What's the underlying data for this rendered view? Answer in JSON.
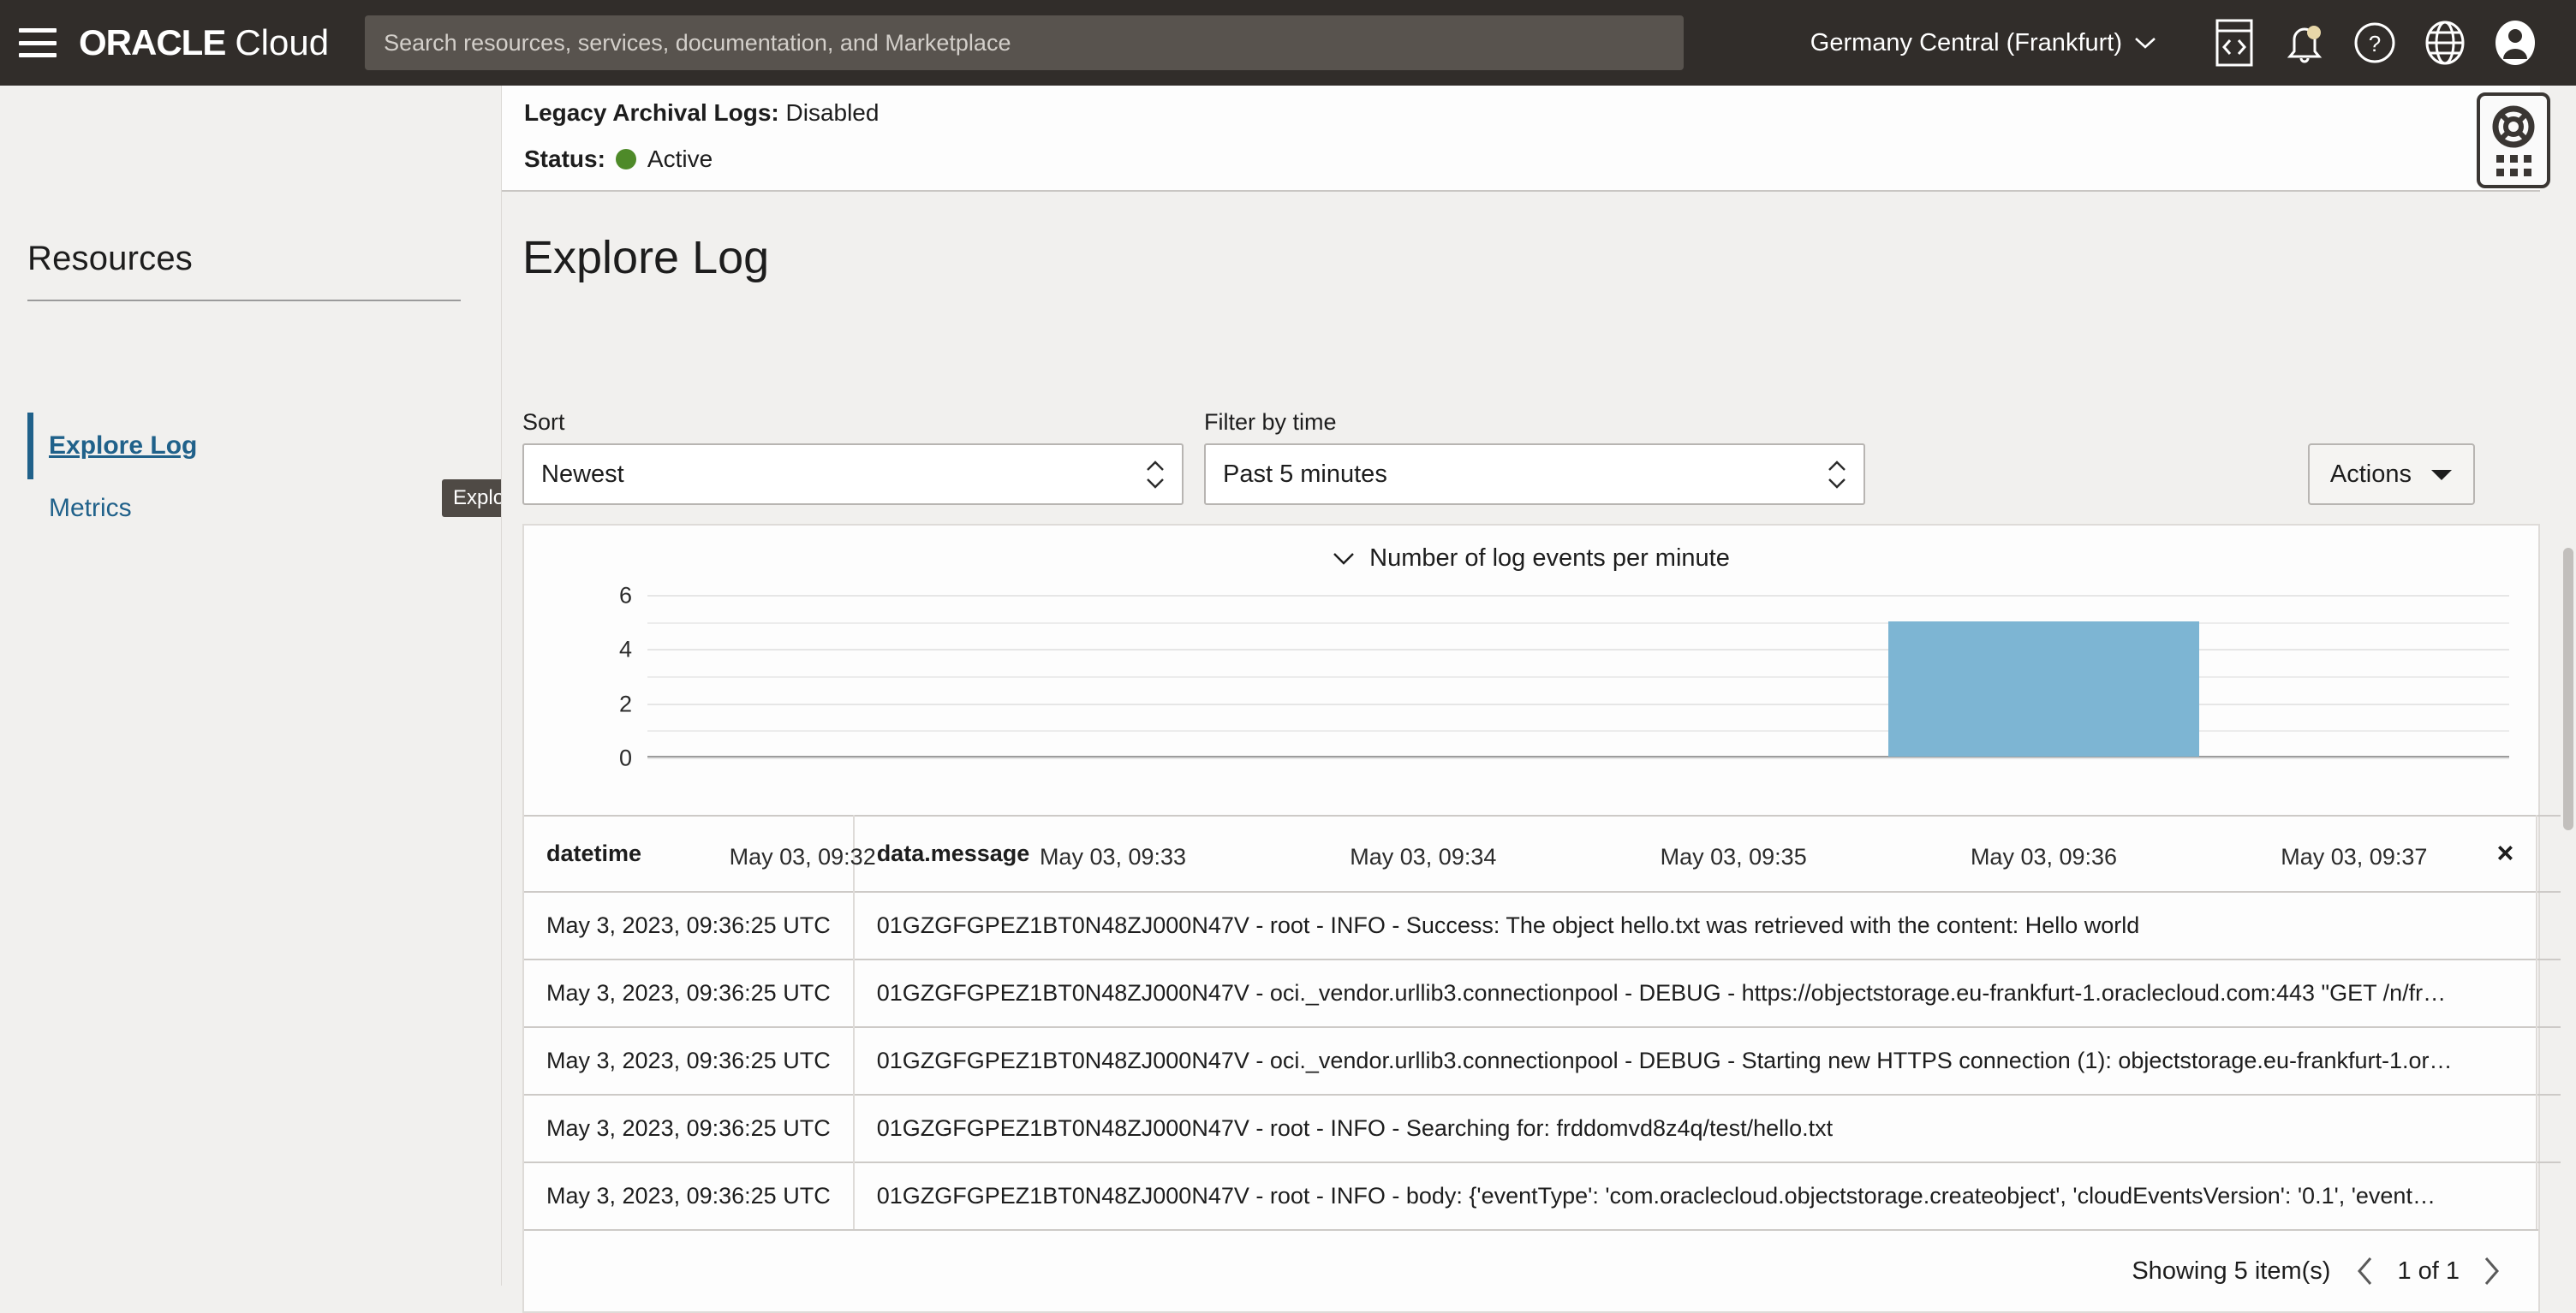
{
  "topnav": {
    "brand_oracle": "ORACLE",
    "brand_cloud": "Cloud",
    "search_placeholder": "Search resources, services, documentation, and Marketplace",
    "search_value": "",
    "region": "Germany Central (Frankfurt)",
    "icons": [
      "cloud-shell-icon",
      "notifications-bell-icon",
      "help-icon",
      "language-globe-icon",
      "user-avatar-icon"
    ]
  },
  "sidebar": {
    "title": "Resources",
    "items": [
      {
        "label": "Explore Log",
        "selected": true
      },
      {
        "label": "Metrics",
        "selected": false
      }
    ],
    "tooltip": "Explore Log"
  },
  "details": {
    "legacy_archival_logs_label": "Legacy Archival Logs:",
    "legacy_archival_logs_value": "Disabled",
    "status_label": "Status:",
    "status_value": "Active",
    "status_color": "#4e8a29"
  },
  "main": {
    "page_title": "Explore Log",
    "sort_label": "Sort",
    "sort_value": "Newest",
    "filter_label": "Filter by time",
    "filter_value": "Past 5 minutes",
    "actions_label": "Actions"
  },
  "chart_data": {
    "type": "bar",
    "title": "Number of log events per minute",
    "xlabel": "",
    "ylabel": "",
    "categories": [
      "May 03, 09:32",
      "May 03, 09:33",
      "May 03, 09:34",
      "May 03, 09:35",
      "May 03, 09:36",
      "May 03, 09:37"
    ],
    "values": [
      0,
      0,
      0,
      0,
      5,
      0
    ],
    "ylim": [
      0,
      6
    ],
    "yticks": [
      0,
      2,
      4,
      6
    ],
    "gridlines": [
      0,
      1,
      2,
      3,
      4,
      5,
      6
    ],
    "grid": true,
    "legend": "none",
    "bar_color": "#7db5d3"
  },
  "table": {
    "columns": [
      "datetime",
      "data.message"
    ],
    "close_icon": "×",
    "rows": [
      {
        "datetime": "May 3, 2023, 09:36:25 UTC",
        "message": "01GZGFGPEZ1BT0N48ZJ000N47V - root - INFO - Success: The object hello.txt was retrieved with the content: Hello world"
      },
      {
        "datetime": "May 3, 2023, 09:36:25 UTC",
        "message": "01GZGFGPEZ1BT0N48ZJ000N47V - oci._vendor.urllib3.connectionpool - DEBUG - https://objectstorage.eu-frankfurt-1.oraclecloud.com:443 \"GET /n/fr…"
      },
      {
        "datetime": "May 3, 2023, 09:36:25 UTC",
        "message": "01GZGFGPEZ1BT0N48ZJ000N47V - oci._vendor.urllib3.connectionpool - DEBUG - Starting new HTTPS connection (1): objectstorage.eu-frankfurt-1.or…"
      },
      {
        "datetime": "May 3, 2023, 09:36:25 UTC",
        "message": "01GZGFGPEZ1BT0N48ZJ000N47V - root - INFO - Searching for: frddomvd8z4q/test/hello.txt"
      },
      {
        "datetime": "May 3, 2023, 09:36:25 UTC",
        "message": "01GZGFGPEZ1BT0N48ZJ000N47V - root - INFO - body: {'eventType': 'com.oraclecloud.objectstorage.createobject', 'cloudEventsVersion': '0.1', 'event…"
      }
    ]
  },
  "pagination": {
    "showing": "Showing 5 item(s)",
    "page_indicator": "1 of 1"
  }
}
